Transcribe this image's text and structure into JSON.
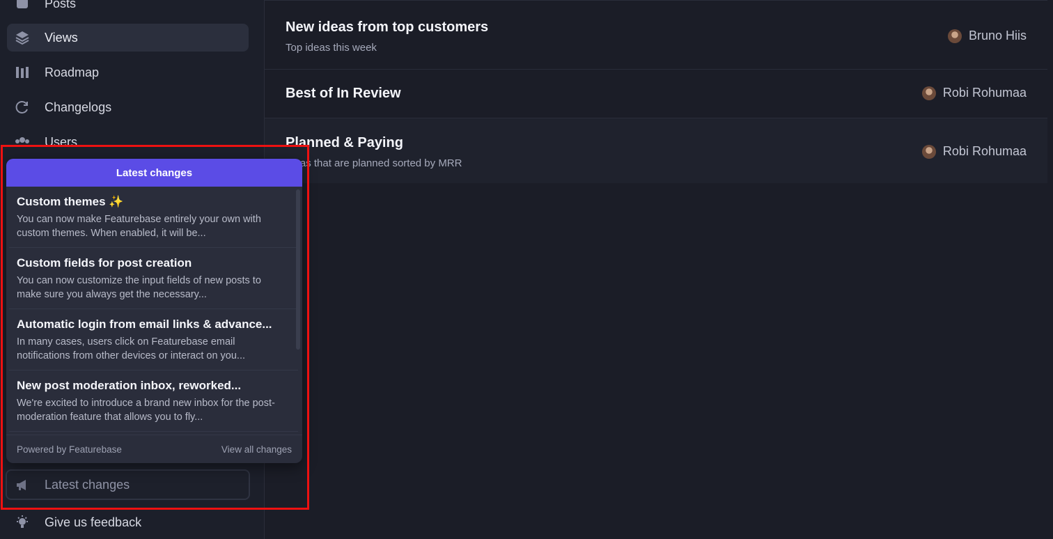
{
  "sidebar": {
    "items": [
      {
        "label": "Posts",
        "icon": "posts-icon"
      },
      {
        "label": "Views",
        "icon": "layers-icon",
        "active": true
      },
      {
        "label": "Roadmap",
        "icon": "roadmap-icon"
      },
      {
        "label": "Changelogs",
        "icon": "refresh-icon"
      },
      {
        "label": "Users",
        "icon": "users-icon"
      }
    ],
    "latest_changes_button": "Latest changes",
    "feedback_button": "Give us feedback"
  },
  "views": [
    {
      "title": "New ideas from top customers",
      "subtitle": "Top ideas this week",
      "owner": "Bruno Hiis"
    },
    {
      "title": "Best of In Review",
      "subtitle": "",
      "owner": "Robi Rohumaa"
    },
    {
      "title": "Planned & Paying",
      "subtitle": "Ideas that are planned sorted by MRR",
      "owner": "Robi Rohumaa"
    }
  ],
  "popup": {
    "header": "Latest changes",
    "items": [
      {
        "title": "Custom themes ✨",
        "description": "You can now make Featurebase entirely your own with custom themes. When enabled, it will be..."
      },
      {
        "title": "Custom fields for post creation",
        "description": "You can now customize the input fields of new posts to make sure you always get the necessary..."
      },
      {
        "title": "Automatic login from email links & advance...",
        "description": "In many cases, users click on Featurebase email notifications from other devices or interact on you..."
      },
      {
        "title": "New post moderation inbox, reworked...",
        "description": "We're excited to introduce a brand new inbox for the post-moderation feature that allows you to fly..."
      }
    ],
    "footer_left": "Powered by Featurebase",
    "footer_right": "View all changes"
  },
  "colors": {
    "accent": "#5b4ce6",
    "highlight_box": "#ee1111",
    "background": "#1b1d27"
  }
}
